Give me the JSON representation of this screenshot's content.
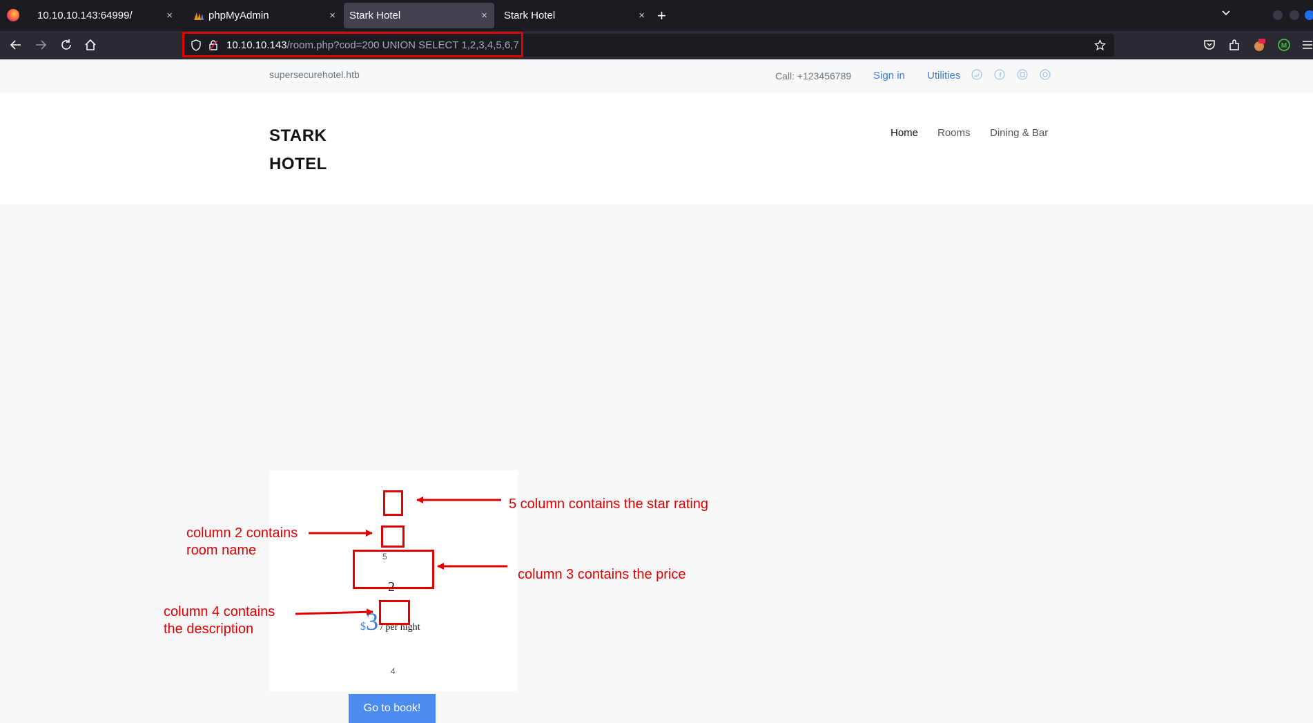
{
  "browser": {
    "tabs": [
      {
        "title": "10.10.10.143:64999/",
        "close": "×",
        "active": false
      },
      {
        "title": "phpMyAdmin",
        "close": "×",
        "active": false
      },
      {
        "title": "Stark Hotel",
        "close": "×",
        "active": true
      },
      {
        "title": "Stark Hotel",
        "close": "×",
        "active": false
      }
    ],
    "new_tab": "+",
    "url": {
      "host": "10.10.10.143",
      "path": "/room.php?cod=200 UNION SELECT 1,2,3,4,5,6,7"
    },
    "icons": {
      "logo": "firefox-logo-icon",
      "back": "arrow-left-icon",
      "forward": "arrow-right-icon",
      "reload": "reload-icon",
      "home": "home-icon",
      "shield": "shield-icon",
      "lock": "lock-icon",
      "bookmark": "star-icon",
      "pocket": "pocket-icon",
      "extensions": "puzzle-icon",
      "menu": "hamburger-icon"
    }
  },
  "site": {
    "domain": "supersecurehotel.htb",
    "call": "Call: +123456789",
    "signin": "Sign in",
    "utilities": "Utilities",
    "brand_line1": "STARK",
    "brand_line2": "HOTEL",
    "nav": [
      "Home",
      "Rooms",
      "Dining & Bar"
    ],
    "link_color": "#3b7bd8"
  },
  "room": {
    "stars": "5",
    "name": "2",
    "currency": "$",
    "price": "3",
    "per_night": "/ per night",
    "description": "4",
    "book_label": "Go to book!"
  },
  "annotations": {
    "stars_note": "5 column contains the star rating",
    "name_note_1": "column 2 contains",
    "name_note_2": "room name",
    "price_note": "column 3 contains the price",
    "desc_note_1": "column 4 contains",
    "desc_note_2": "the description",
    "color": "#e00000"
  }
}
